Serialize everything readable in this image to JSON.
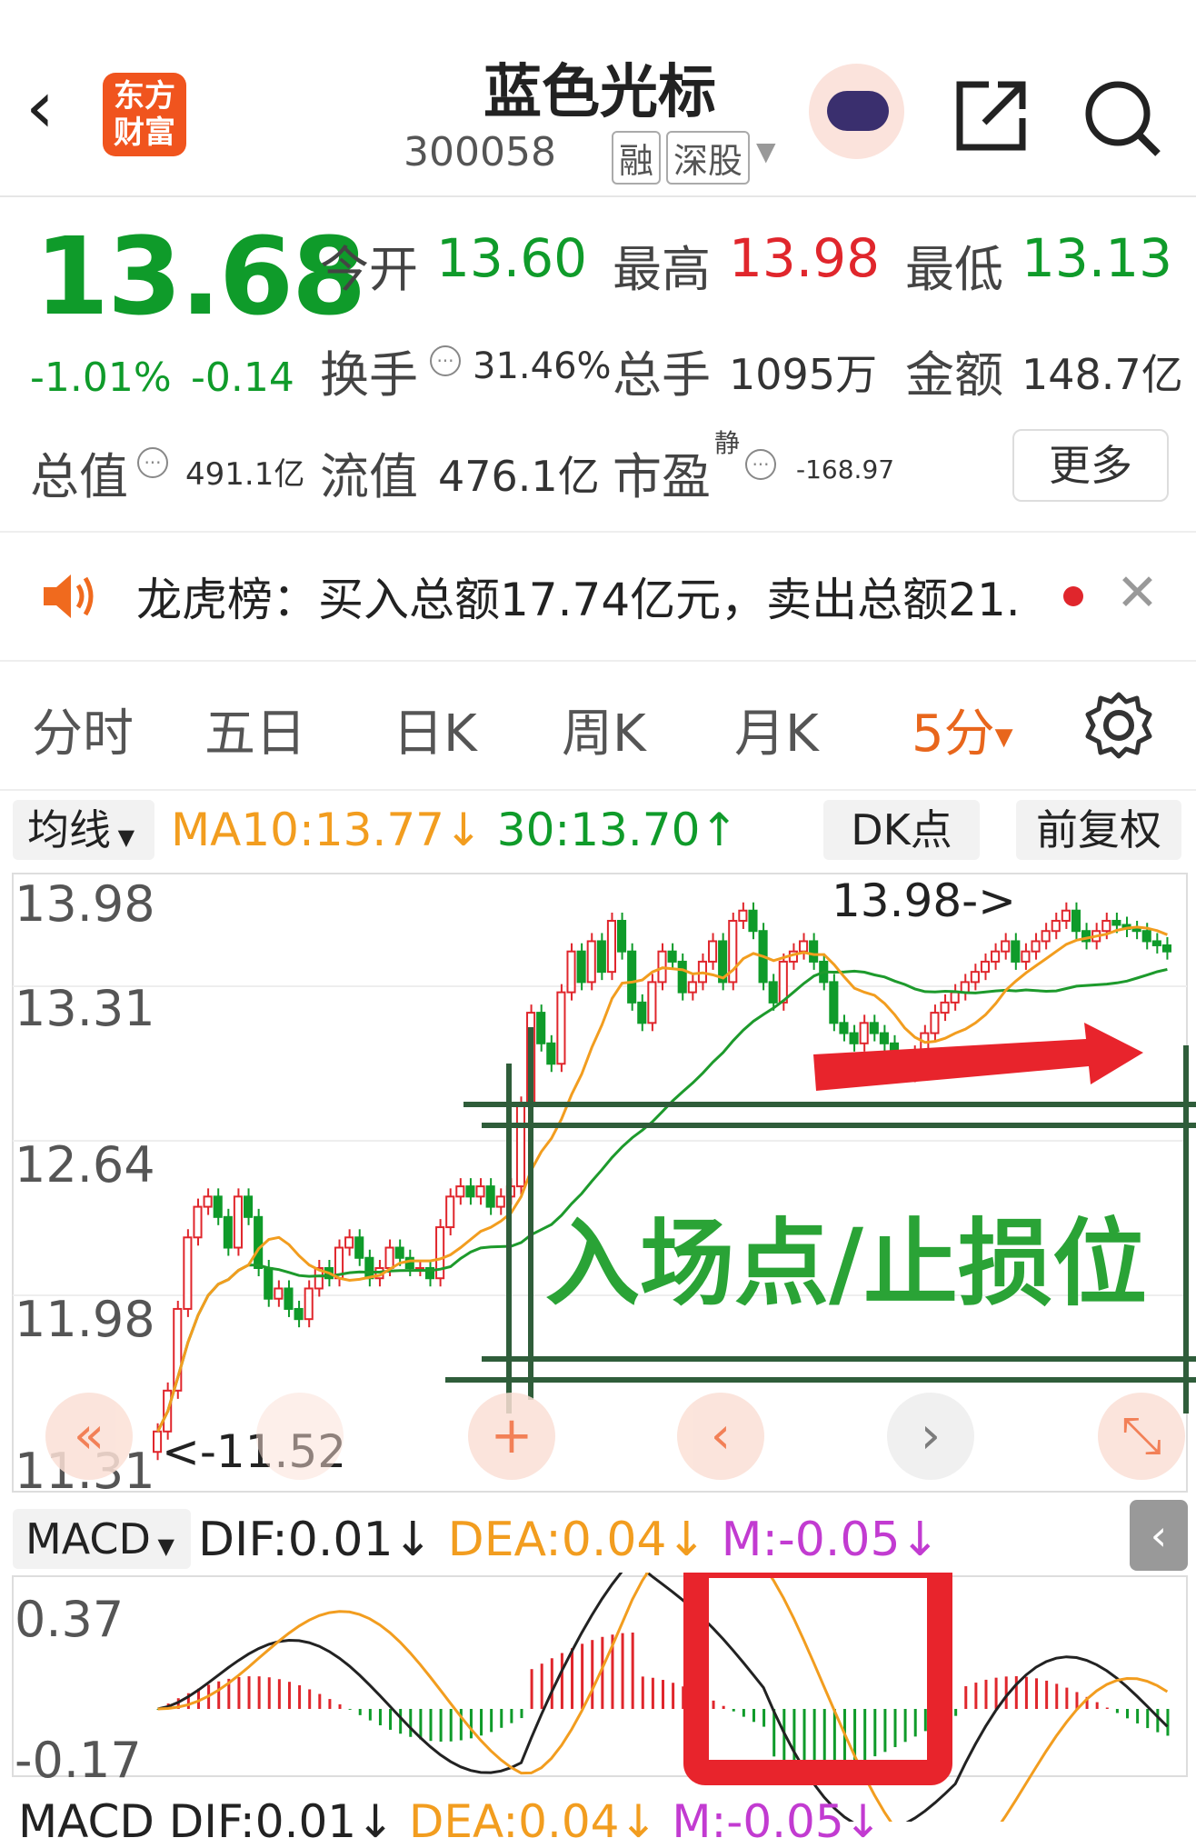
{
  "header": {
    "back": "‹",
    "logo_line1": "东方",
    "logo_line2": "财富",
    "stock_name": "蓝色光标",
    "stock_code": "300058",
    "tag_rong": "融",
    "tag_market": "深股",
    "tag_arrow": "▼"
  },
  "quote": {
    "price": "13.68",
    "change_pct": "-1.01%",
    "change": "-0.14",
    "open_label": "今开",
    "open": "13.60",
    "high_label": "最高",
    "high": "13.98",
    "low_label": "最低",
    "low": "13.13",
    "turnover_label": "换手",
    "turnover": "31.46%",
    "volume_label": "总手",
    "volume": "1095万",
    "amount_label": "金额",
    "amount": "148.7亿",
    "mcap_label": "总值",
    "mcap": "491.1亿",
    "float_label": "流值",
    "float_cap": "476.1亿",
    "pe_label": "市盈",
    "pe_sup": "静",
    "pe": "-168.97",
    "more": "更多"
  },
  "notice": {
    "text": "龙虎榜：买入总额17.74亿元，卖出总额21."
  },
  "tabs": [
    "分时",
    "五日",
    "日K",
    "周K",
    "月K",
    "5分"
  ],
  "tab_arrow": "▼",
  "ma_bar": {
    "select": "均线",
    "ma10": "MA10:13.77↓",
    "ma30": "30:13.70↑",
    "dk": "DK点",
    "fq": "前复权"
  },
  "kchart": {
    "y_labels": [
      "13.98",
      "13.31",
      "12.64",
      "11.98",
      "11.31"
    ],
    "high_marker": "13.98->",
    "low_marker": "<-11.52",
    "annotation": "入场点/止损位"
  },
  "nav": {
    "rewind": "«",
    "zoom_in": "+",
    "prev": "‹",
    "next": "›",
    "expand": "⤡"
  },
  "macd": {
    "select": "MACD",
    "dif": "DIF:0.01↓",
    "dea": "DEA:0.04↓",
    "m": "M:-0.05↓",
    "y_top": "0.37",
    "y_bottom": "-0.17",
    "collapse": "‹"
  },
  "colors": {
    "up": "#e0262c",
    "down": "#0f9b2a",
    "accent": "#e8661c",
    "ma10": "#f29d1f",
    "ma30": "#1d9a2c"
  }
}
